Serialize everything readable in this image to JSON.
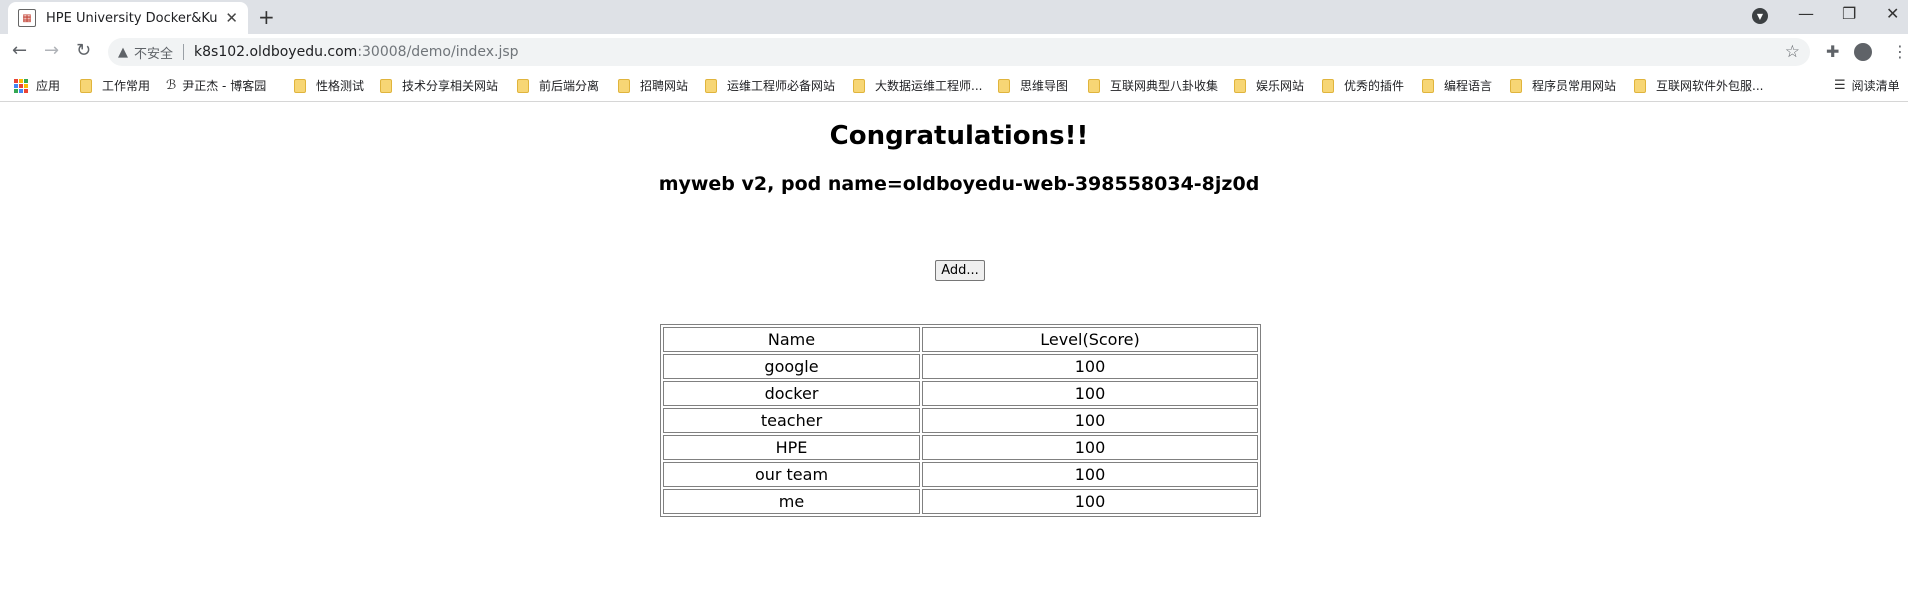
{
  "browser": {
    "tab_title": "HPE University Docker&Kubern",
    "url_warning": "不安全",
    "url_host": "k8s102.oldboyedu.com",
    "url_path": ":30008/demo/index.jsp"
  },
  "bookmarks": [
    {
      "label": "应用",
      "icon": "apps-icon"
    },
    {
      "label": "工作常用",
      "icon": "folder-icon"
    },
    {
      "label": "尹正杰 - 博客园",
      "icon": "blog-icon"
    },
    {
      "label": "性格测试",
      "icon": "folder-icon"
    },
    {
      "label": "技术分享相关网站",
      "icon": "folder-icon"
    },
    {
      "label": "前后端分离",
      "icon": "folder-icon"
    },
    {
      "label": "招聘网站",
      "icon": "folder-icon"
    },
    {
      "label": "运维工程师必备网站",
      "icon": "folder-icon"
    },
    {
      "label": "大数据运维工程师...",
      "icon": "folder-icon"
    },
    {
      "label": "思维导图",
      "icon": "folder-icon"
    },
    {
      "label": "互联网典型八卦收集",
      "icon": "folder-icon"
    },
    {
      "label": "娱乐网站",
      "icon": "folder-icon"
    },
    {
      "label": "优秀的插件",
      "icon": "folder-icon"
    },
    {
      "label": "编程语言",
      "icon": "folder-icon"
    },
    {
      "label": "程序员常用网站",
      "icon": "folder-icon"
    },
    {
      "label": "互联网软件外包服...",
      "icon": "folder-icon"
    },
    {
      "label": "阅读清单",
      "icon": "reading-list-icon"
    }
  ],
  "page": {
    "heading": "Congratulations!!",
    "subheading": "myweb v2, pod name=oldboyedu-web-398558034-8jz0d",
    "add_button": "Add...",
    "table": {
      "headers": [
        "Name",
        "Level(Score)"
      ],
      "rows": [
        [
          "google",
          "100"
        ],
        [
          "docker",
          "100"
        ],
        [
          "teacher",
          "100"
        ],
        [
          "HPE",
          "100"
        ],
        [
          "our team",
          "100"
        ],
        [
          "me",
          "100"
        ]
      ]
    }
  }
}
